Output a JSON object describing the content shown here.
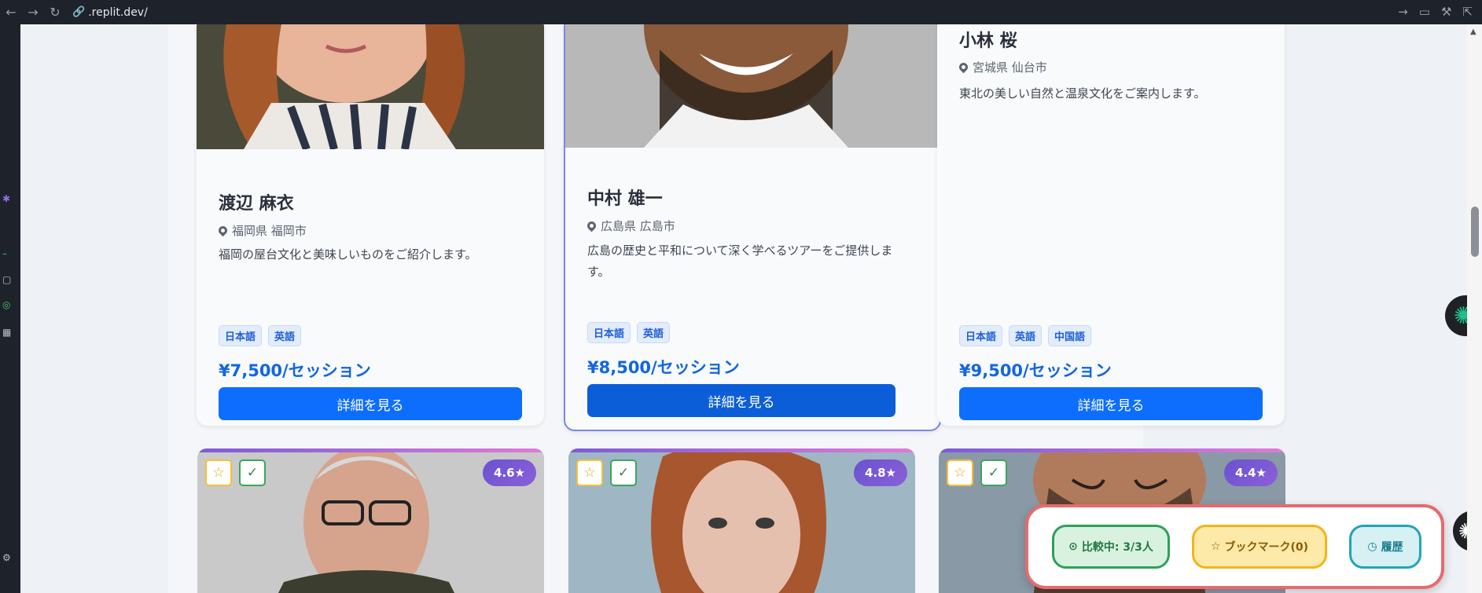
{
  "browser": {
    "url": ".replit.dev/",
    "back_icon": "arrow-left-icon",
    "forward_icon": "arrow-right-icon",
    "reload_icon": "reload-icon"
  },
  "cards_top": [
    {
      "name": "渡辺 麻衣",
      "location": "福岡県 福岡市",
      "description": "福岡の屋台文化と美味しいものをご紹介します。",
      "tags": [
        "日本語",
        "英語"
      ],
      "price": "¥7,500/セッション",
      "button": "詳細を見る"
    },
    {
      "name": "中村 雄一",
      "location": "広島県 広島市",
      "description": "広島の歴史と平和について深く学べるツアーをご提供します。",
      "tags": [
        "日本語",
        "英語"
      ],
      "price": "¥8,500/セッション",
      "button": "詳細を見る"
    },
    {
      "name": "小林 桜",
      "location": "宮城県 仙台市",
      "description": "東北の美しい自然と温泉文化をご案内します。",
      "tags": [
        "日本語",
        "英語",
        "中国語"
      ],
      "price": "¥9,500/セッション",
      "button": "詳細を見る"
    }
  ],
  "cards_bottom": [
    {
      "rating": "4.6★"
    },
    {
      "rating": "4.8★"
    },
    {
      "rating": "4.4★"
    }
  ],
  "floatbar": {
    "compare": "比較中: 3/3人",
    "bookmark": "ブックマーク(0)",
    "history": "履歴"
  },
  "colors": {
    "primary": "#0d6efd",
    "price": "#1266e0",
    "rating": "#6a52d0",
    "floatbar_border": "#e56b6f"
  }
}
